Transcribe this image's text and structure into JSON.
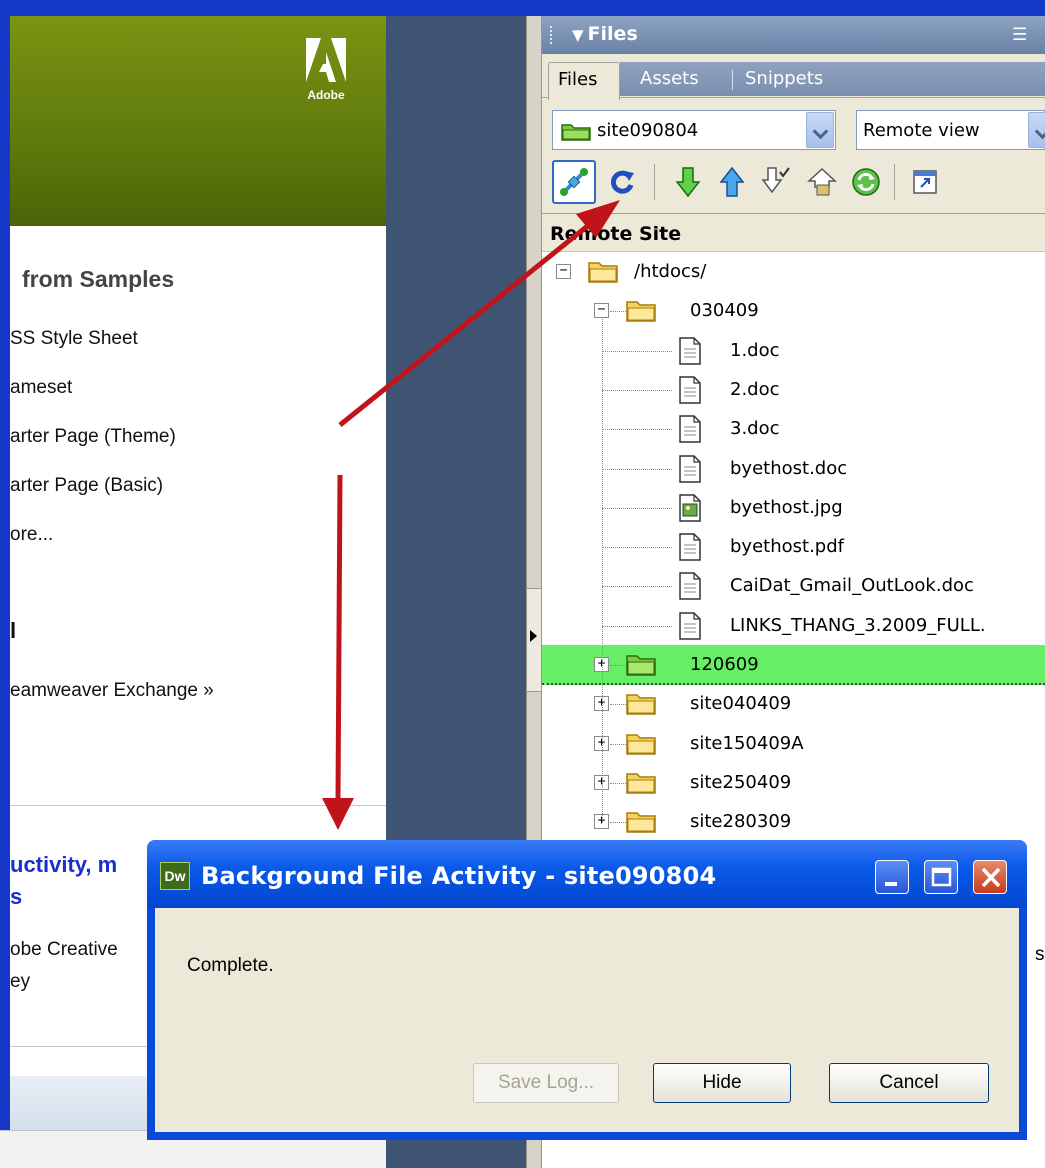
{
  "start_page": {
    "brand": "Adobe",
    "section_title": "from Samples",
    "samples": [
      "SS Style Sheet",
      "ameset",
      "arter Page (Theme)",
      "arter Page (Basic)",
      "ore..."
    ],
    "bracket_text": "l",
    "exchange_link": "eamweaver Exchange »",
    "news_title": "uctivity, m",
    "news_sub": "s",
    "news_body": [
      "obe Creative",
      "ey"
    ]
  },
  "files_panel": {
    "title": "Files",
    "tabs": [
      "Files",
      "Assets",
      "Snippets"
    ],
    "site_select": "site090804",
    "view_select": "Remote view",
    "tree_header": "Remote Site",
    "tree": [
      {
        "name": "/htdocs/",
        "type": "folder",
        "level": 0,
        "expander": "−"
      },
      {
        "name": "030409",
        "type": "folder",
        "level": 1,
        "expander": "−"
      },
      {
        "name": "1.doc",
        "type": "doc",
        "level": 2
      },
      {
        "name": "2.doc",
        "type": "doc",
        "level": 2
      },
      {
        "name": "3.doc",
        "type": "doc",
        "level": 2
      },
      {
        "name": "byethost.doc",
        "type": "doc",
        "level": 2
      },
      {
        "name": "byethost.jpg",
        "type": "image",
        "level": 2
      },
      {
        "name": "byethost.pdf",
        "type": "doc",
        "level": 2
      },
      {
        "name": "CaiDat_Gmail_OutLook.doc",
        "type": "doc",
        "level": 2
      },
      {
        "name": "LINKS_THANG_3.2009_FULL.",
        "type": "doc",
        "level": 2
      },
      {
        "name": "120609",
        "type": "folder",
        "level": 1,
        "expander": "+",
        "highlight": true
      },
      {
        "name": "site040409",
        "type": "folder",
        "level": 1,
        "expander": "+"
      },
      {
        "name": "site150409A",
        "type": "folder",
        "level": 1,
        "expander": "+"
      },
      {
        "name": "site250409",
        "type": "folder",
        "level": 1,
        "expander": "+"
      },
      {
        "name": "site280309",
        "type": "folder",
        "level": 1,
        "expander": "+"
      }
    ]
  },
  "dialog": {
    "logo": "Dw",
    "title": "Background File Activity - site090804",
    "message": "Complete.",
    "buttons": {
      "save_log": "Save Log...",
      "hide": "Hide",
      "cancel": "Cancel"
    }
  },
  "right_edge_text": "s",
  "colors": {
    "frame_blue": "#1638c8",
    "banner_green": "#6a860e",
    "highlight_green": "#66ef66",
    "arrow_red": "#c0141a",
    "xp_title_blue": "#0a5ae8"
  }
}
